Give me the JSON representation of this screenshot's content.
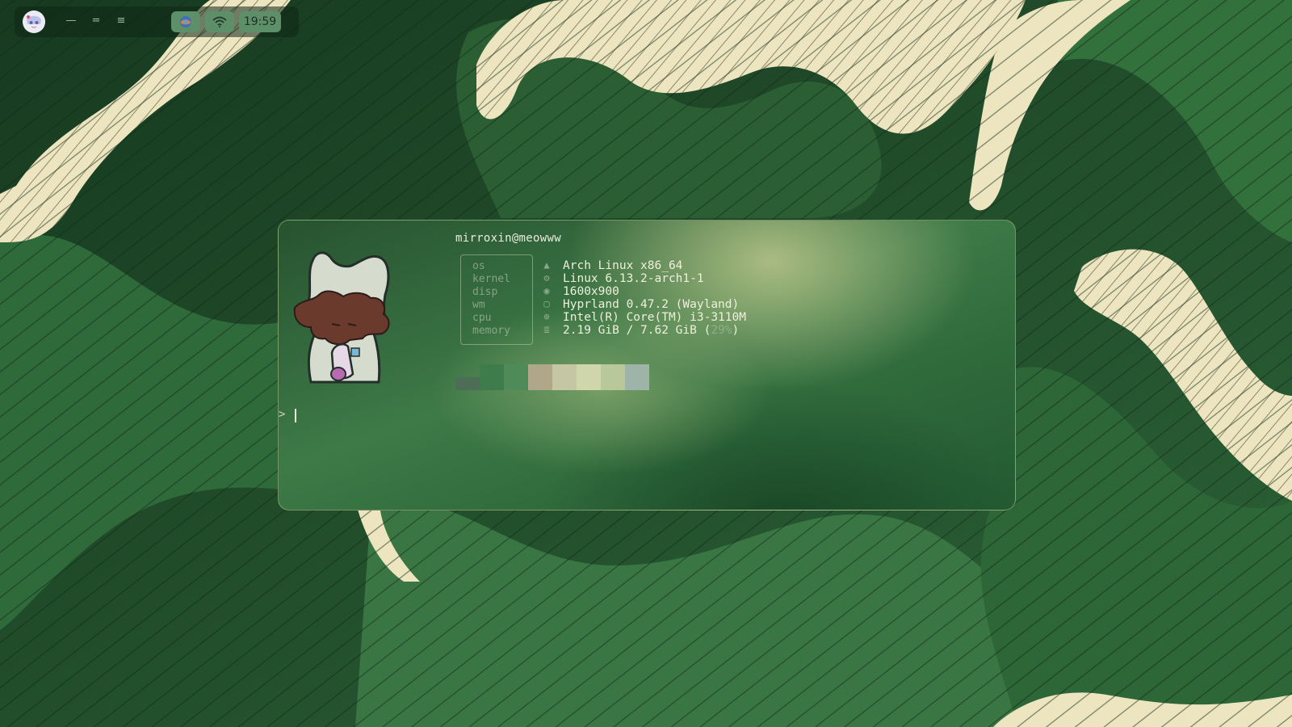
{
  "topbar": {
    "avatar_icon": "anime-avatar-icon",
    "workspace_icons": [
      "workspace-1-icon",
      "workspace-2-icon",
      "workspace-3-icon"
    ],
    "app_icon": "browser-app-icon",
    "wifi_icon": "wifi-icon",
    "clock": "19:59"
  },
  "terminal": {
    "userhost": "mirroxin@meowww",
    "fetch_rows": [
      {
        "key": "os",
        "icon": "arch-logo-icon",
        "value": "Arch Linux x86_64"
      },
      {
        "key": "kernel",
        "icon": "kernel-icon",
        "value": "Linux 6.13.2-arch1-1"
      },
      {
        "key": "disp",
        "icon": "display-icon",
        "value": "1600x900"
      },
      {
        "key": "wm",
        "icon": "window-icon",
        "value": "Hyprland 0.47.2 (Wayland)"
      },
      {
        "key": "cpu",
        "icon": "cpu-icon",
        "value": "Intel(R) Core(TM) i3-3110M"
      },
      {
        "key": "memory",
        "icon": "memory-icon",
        "value": "2.19 GiB / 7.62 GiB (",
        "value_pct": "29%",
        "value_end": ")"
      }
    ],
    "palette_colors": [
      "#4d6d57",
      "#3f7c4c",
      "#4f8b59",
      "#b0a78a",
      "#c5c7a4",
      "#cfd6ac",
      "#b8c89b",
      "#9fb4a8"
    ],
    "prompt": ">"
  },
  "colors": {
    "wallpaper_dark": "#1a3d22",
    "wallpaper_mid": "#3f7a48",
    "wallpaper_cream": "#ece5bf",
    "terminal_text": "#eef0dc"
  }
}
